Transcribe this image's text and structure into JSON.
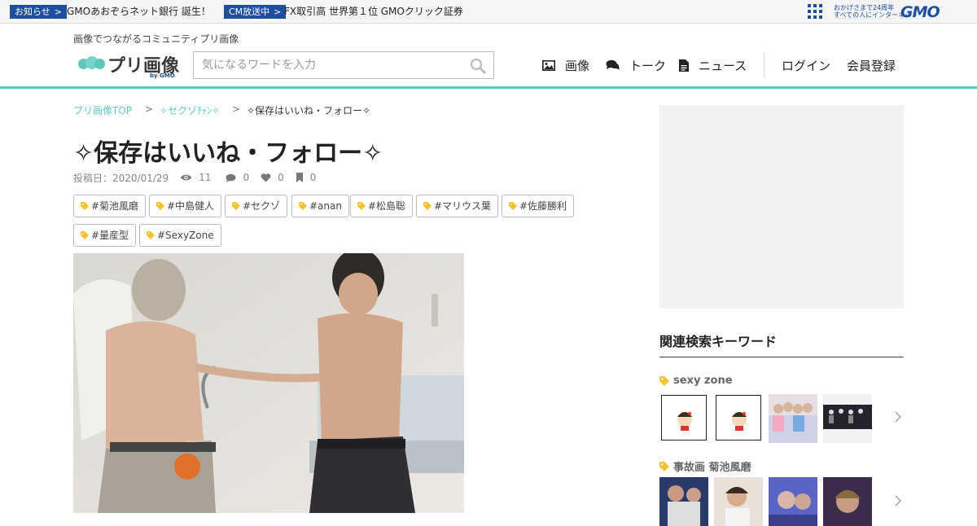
{
  "topbar": {
    "notice_badge": "お知らせ",
    "notice_text": "GMOあおぞらネット銀行 誕生！",
    "cm_badge": "CM放送中",
    "cm_text": "FX取引高 世界第１位 GMOクリック証券",
    "gmo_tagline_1": "おかげさまで24周年",
    "gmo_tagline_2": "すべての人にインターネット",
    "gmo_logo": "GMO"
  },
  "header": {
    "tagline": "画像でつながるコミュニティプリ画像",
    "logo_text": "プリ画像",
    "logo_by": "by GMO",
    "search_placeholder": "気になるワードを入力",
    "nav": {
      "images": "画像",
      "talk": "トーク",
      "news": "ニュース",
      "login": "ログイン",
      "register": "会員登録"
    }
  },
  "breadcrumb": {
    "home": "プリ画像TOP",
    "category": "✧セクゾﾁｬﾝ✧",
    "current": "✧保存はいいね・フォロー✧",
    "separator": ">"
  },
  "post": {
    "title": "✧保存はいいね・フォロー✧",
    "date": "投稿日：2020/01/29",
    "views": "11",
    "comments": "0",
    "likes": "0",
    "saves": "0",
    "tags": [
      "#菊池風磨",
      "#中島健人",
      "#セクゾ",
      "#anan",
      "#松島聡",
      "#マリウス葉",
      "#佐藤勝利",
      "#量産型",
      "#SexyZone"
    ]
  },
  "sidebar": {
    "related_heading": "関連検索キーワード",
    "groups": [
      {
        "label": "sexy zone"
      },
      {
        "label": "事故画 菊池風磨"
      }
    ]
  },
  "colors": {
    "accent": "#5ec8bd",
    "gmo_blue": "#1d4f9e",
    "tag_icon": "#f2c230"
  }
}
